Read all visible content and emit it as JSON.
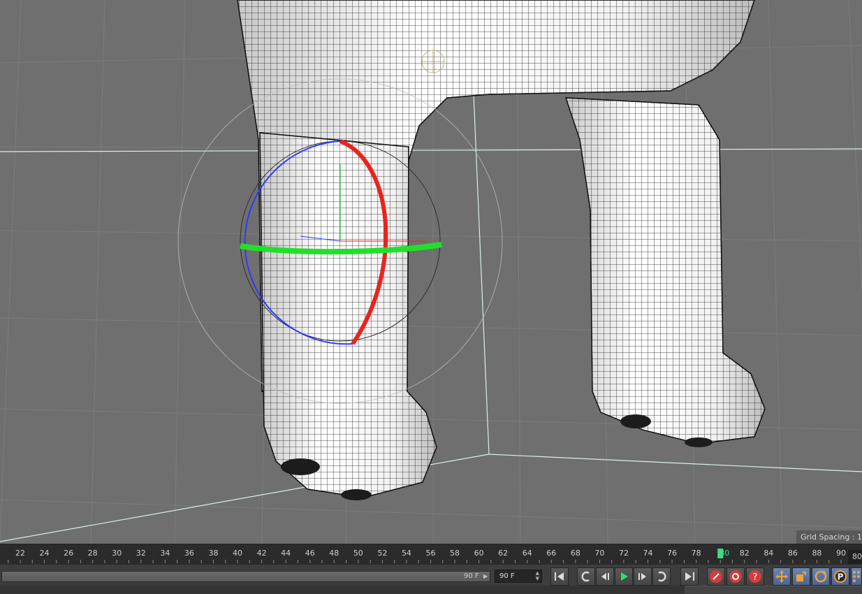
{
  "viewport": {
    "grid_spacing_label": "Grid Spacing : 1"
  },
  "timeline": {
    "ticks": [
      "22",
      "24",
      "26",
      "28",
      "30",
      "32",
      "34",
      "36",
      "38",
      "40",
      "42",
      "44",
      "46",
      "48",
      "50",
      "52",
      "54",
      "56",
      "58",
      "60",
      "62",
      "64",
      "66",
      "68",
      "70",
      "72",
      "74",
      "76",
      "78",
      "80",
      "82",
      "84",
      "86",
      "88",
      "90"
    ],
    "current_frame": "80",
    "end_field": "80"
  },
  "controls": {
    "range_end_label": "90 F",
    "frame_field_value": "90 F",
    "buttons": [
      {
        "name": "go-to-start-button",
        "icon": "go-to-start-icon"
      },
      {
        "name": "previous-key-button",
        "icon": "previous-key-icon"
      },
      {
        "name": "previous-frame-button",
        "icon": "previous-frame-icon"
      },
      {
        "name": "play-button",
        "icon": "play-icon"
      },
      {
        "name": "next-frame-button",
        "icon": "next-frame-icon"
      },
      {
        "name": "next-key-button",
        "icon": "next-key-icon"
      },
      {
        "name": "go-to-end-button",
        "icon": "go-to-end-icon"
      },
      {
        "name": "record-active-objects-button",
        "icon": "record-icon"
      },
      {
        "name": "autokeying-button",
        "icon": "autokey-icon"
      },
      {
        "name": "keyframe-selection-button",
        "icon": "help-key-icon"
      },
      {
        "name": "record-position-button",
        "icon": "move-icon"
      },
      {
        "name": "record-scale-button",
        "icon": "scale-icon"
      },
      {
        "name": "record-rotation-button",
        "icon": "rotate-icon"
      },
      {
        "name": "record-parameter-button",
        "icon": "parameter-icon"
      },
      {
        "name": "record-pla-button",
        "icon": "pla-icon"
      }
    ]
  },
  "colors": {
    "viewport_bg": "#6f6f6f",
    "axis_x": "#e8241e",
    "axis_y": "#22e02a",
    "axis_z": "#2a3bff",
    "current_frame_marker": "#3ddc84"
  }
}
